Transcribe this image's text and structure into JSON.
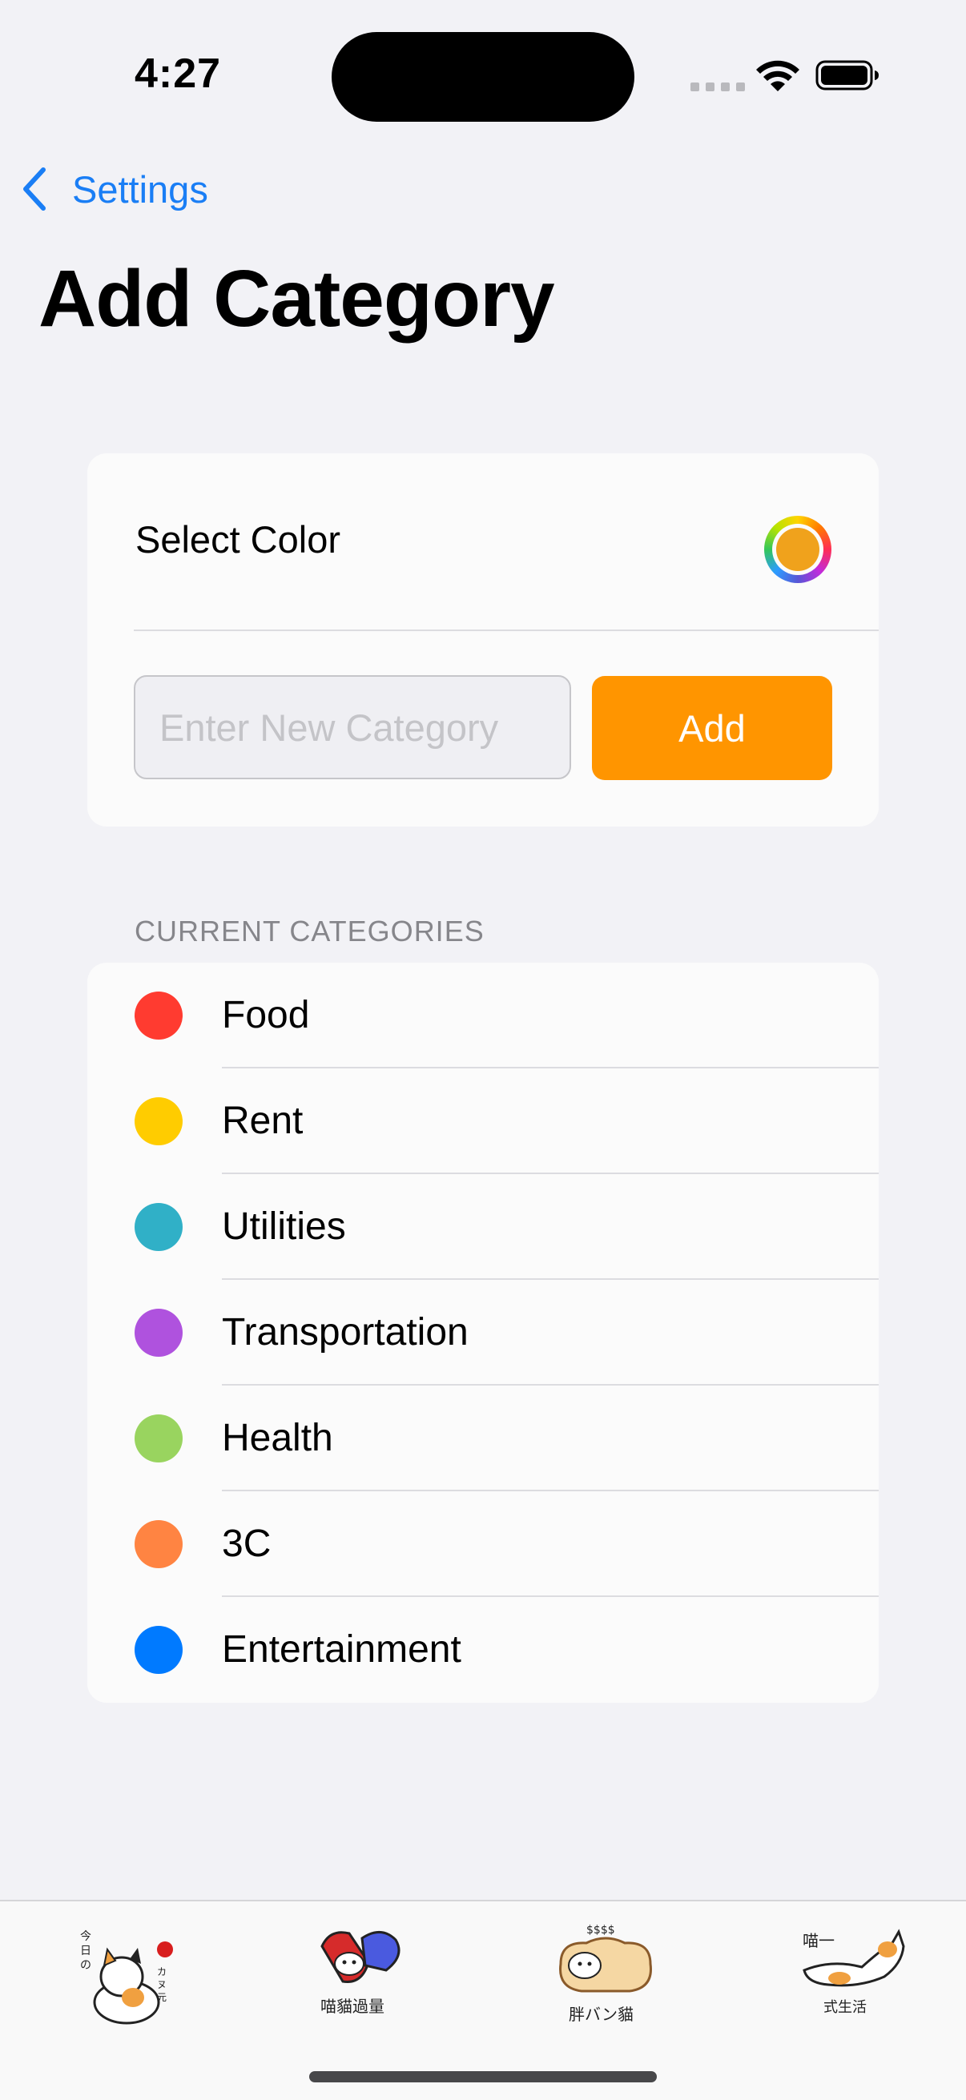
{
  "status_bar": {
    "time": "4:27"
  },
  "nav": {
    "back_label": "Settings",
    "title": "Add Category"
  },
  "add_form": {
    "select_color_label": "Select Color",
    "selected_color": "#f0a21c",
    "input_value": "",
    "input_placeholder": "Enter New Category",
    "add_button_label": "Add",
    "add_button_color": "#ff9500"
  },
  "categories_section": {
    "header": "CURRENT CATEGORIES",
    "items": [
      {
        "name": "Food",
        "color": "#ff3b30"
      },
      {
        "name": "Rent",
        "color": "#ffcc00"
      },
      {
        "name": "Utilities",
        "color": "#30b0c7"
      },
      {
        "name": "Transportation",
        "color": "#af52de"
      },
      {
        "name": "Health",
        "color": "#99d45f"
      },
      {
        "name": "3C",
        "color": "#ff8442"
      },
      {
        "name": "Entertainment",
        "color": "#007aff"
      }
    ]
  },
  "tab_bar": {
    "tabs": [
      {
        "icon": "cat-sticker-tab-icon",
        "label": "今日の喵カヌ元"
      },
      {
        "icon": "capsule-cat-tab-icon",
        "label": "喵貓過量"
      },
      {
        "icon": "bread-cat-tab-icon",
        "label": "胖バン貓"
      },
      {
        "icon": "stretch-cat-tab-icon",
        "label": "喵一式生活"
      }
    ]
  }
}
